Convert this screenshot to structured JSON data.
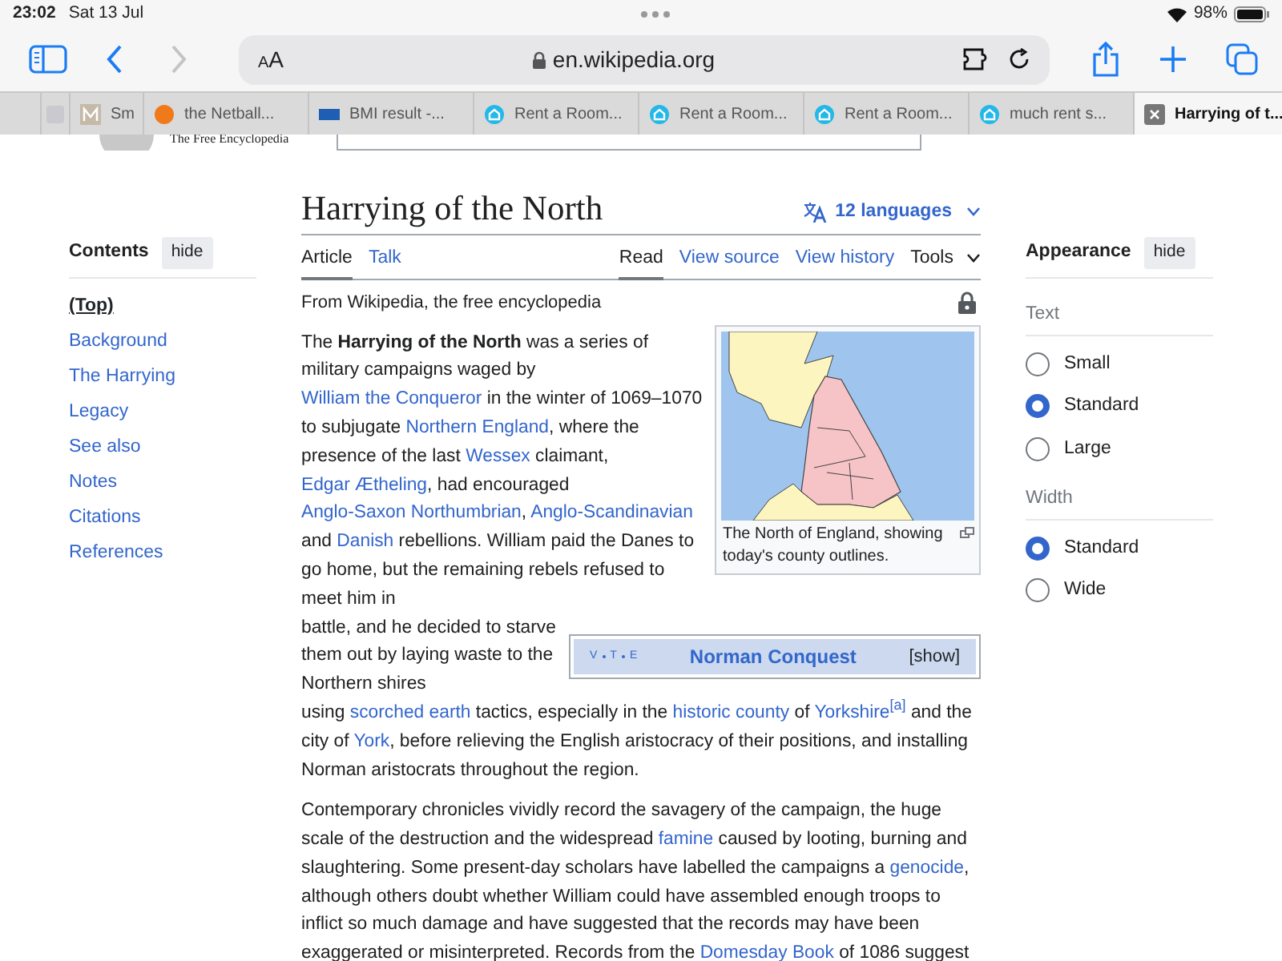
{
  "status_bar": {
    "time": "23:02",
    "date": "Sat 13 Jul",
    "battery": "98%"
  },
  "toolbar": {
    "text_size": "AA",
    "address": "en.wikipedia.org"
  },
  "tabs": [
    {
      "selected": false
    },
    {
      "title": "Sm",
      "selected": false
    },
    {
      "title": "the Netball...",
      "selected": false
    },
    {
      "title": "BMI result -...",
      "selected": false
    },
    {
      "title": "Rent a Room...",
      "selected": false
    },
    {
      "title": "Rent a Room...",
      "selected": false
    },
    {
      "title": "Rent a Room...",
      "selected": false
    },
    {
      "title": "much rent s...",
      "selected": false
    },
    {
      "title": "Harrying of t...",
      "selected": true
    }
  ],
  "site_header": {
    "tagline": "The Free Encyclopedia"
  },
  "toc": {
    "title": "Contents",
    "hide": "hide",
    "items": [
      {
        "label": "(Top)",
        "selected": true
      },
      {
        "label": "Background",
        "selected": false
      },
      {
        "label": "The Harrying",
        "selected": false
      },
      {
        "label": "Legacy",
        "selected": false
      },
      {
        "label": "See also",
        "selected": false
      },
      {
        "label": "Notes",
        "selected": false
      },
      {
        "label": "Citations",
        "selected": false
      },
      {
        "label": "References",
        "selected": false
      }
    ]
  },
  "article": {
    "title": "Harrying of the North",
    "languages": "12 languages",
    "tabs": [
      {
        "label": "Article",
        "selected": true
      },
      {
        "label": "Talk",
        "selected": false
      }
    ],
    "actions": [
      {
        "label": "Read",
        "selected": true,
        "kind": "link"
      },
      {
        "label": "View source",
        "selected": false,
        "kind": "link"
      },
      {
        "label": "View history",
        "selected": false,
        "kind": "link"
      },
      {
        "label": "Tools",
        "selected": false,
        "kind": "menu"
      }
    ],
    "tagline": "From Wikipedia, the free encyclopedia",
    "figure": {
      "caption": "The North of England, showing today's county outlines."
    },
    "navbox": {
      "links": [
        "V",
        "T",
        "E"
      ],
      "title": "Norman Conquest",
      "toggle": "[show]"
    },
    "paragraphs": [
      [
        [
          {
            "kind": "text",
            "text": "The "
          },
          {
            "kind": "bold",
            "text": "Harrying of the North"
          },
          {
            "kind": "text",
            "text": " was a series of military campaigns waged by "
          },
          {
            "kind": "link",
            "text": "William the Conqueror"
          },
          {
            "kind": "text",
            "text": " in the winter of 1069–1070 to subjugate "
          },
          {
            "kind": "link",
            "text": "Northern England"
          },
          {
            "kind": "text",
            "text": ", where the presence of the last "
          },
          {
            "kind": "link",
            "text": "Wessex"
          },
          {
            "kind": "text",
            "text": " claimant, "
          },
          {
            "kind": "link",
            "text": "Edgar Ætheling"
          },
          {
            "kind": "text",
            "text": ", had encouraged "
          },
          {
            "kind": "link",
            "text": "Anglo-Saxon Northumbrian"
          },
          {
            "kind": "text",
            "text": ", "
          },
          {
            "kind": "link",
            "text": "Anglo-Scandinavian"
          },
          {
            "kind": "text",
            "text": " and "
          },
          {
            "kind": "link",
            "text": "Danish"
          },
          {
            "kind": "text",
            "text": " rebellions. William paid the Danes to go home, but the remaining rebels refused to meet him in"
          }
        ],
        [
          {
            "kind": "text",
            "text": "battle, and he decided to starve them out by laying waste to the Northern shires"
          }
        ],
        [
          {
            "kind": "text",
            "text": "using "
          },
          {
            "kind": "link",
            "text": "scorched earth"
          },
          {
            "kind": "text",
            "text": " tactics, especially in the "
          },
          {
            "kind": "link",
            "text": "historic county"
          },
          {
            "kind": "text",
            "text": " of "
          },
          {
            "kind": "link",
            "text": "Yorkshire"
          },
          {
            "kind": "ref",
            "text": "[a]"
          },
          {
            "kind": "text",
            "text": " and the city of "
          },
          {
            "kind": "link",
            "text": "York"
          },
          {
            "kind": "text",
            "text": ", before relieving the English aristocracy of their positions, and installing Norman aristocrats throughout the region."
          }
        ]
      ],
      [
        [
          {
            "kind": "text",
            "text": "Contemporary chronicles vividly record the savagery of the campaign, the huge scale of the destruction and the widespread "
          },
          {
            "kind": "link",
            "text": "famine"
          },
          {
            "kind": "text",
            "text": " caused by looting, burning and slaughtering. Some present-day scholars have labelled the campaigns a "
          },
          {
            "kind": "link",
            "text": "genocide"
          },
          {
            "kind": "text",
            "text": ", although others doubt whether William could have assembled enough troops to inflict so much damage and have suggested that the records may have been exaggerated or misinterpreted. Records from the "
          },
          {
            "kind": "link",
            "text": "Domesday Book"
          },
          {
            "kind": "text",
            "text": " of 1086 suggest"
          }
        ]
      ]
    ]
  },
  "appearance": {
    "title": "Appearance",
    "hide": "hide",
    "groups": [
      {
        "label": "Text",
        "options": [
          {
            "label": "Small",
            "selected": false
          },
          {
            "label": "Standard",
            "selected": true
          },
          {
            "label": "Large",
            "selected": false
          }
        ]
      },
      {
        "label": "Width",
        "options": [
          {
            "label": "Standard",
            "selected": true
          },
          {
            "label": "Wide",
            "selected": false
          }
        ]
      }
    ]
  }
}
